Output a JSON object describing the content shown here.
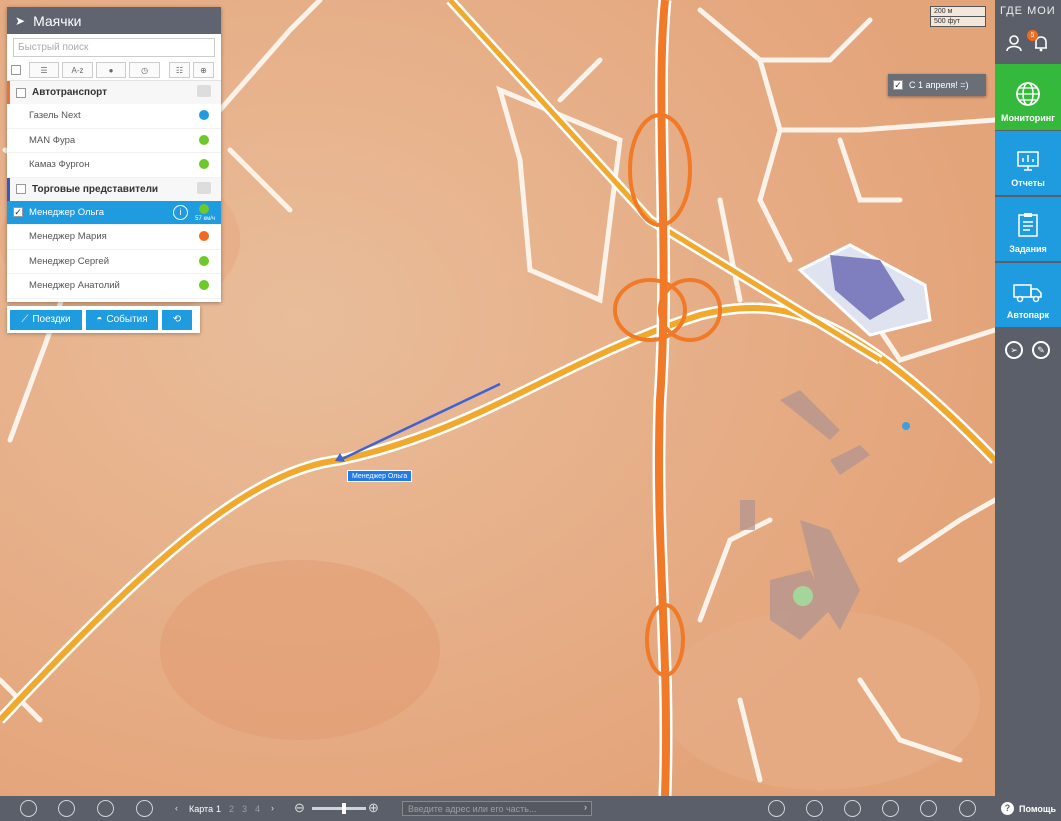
{
  "panel": {
    "title": "Маячки",
    "search_placeholder": "Быстрый поиск",
    "sort_az_label": "A-z",
    "groups": [
      {
        "label": "Автотранспорт",
        "items": [
          {
            "label": "Газель Next",
            "status_color": "#1f9be0"
          },
          {
            "label": "MAN Фура",
            "status_color": "#6dc92a"
          },
          {
            "label": "Камаз Фургон",
            "status_color": "#6dc92a"
          }
        ]
      },
      {
        "label": "Торговые представители",
        "items": [
          {
            "label": "Менеджер Ольга",
            "status_color": "#6dc92a",
            "speed": "57 км/ч",
            "selected": true
          },
          {
            "label": "Менеджер Мария",
            "status_color": "#f06a1f"
          },
          {
            "label": "Менеджер Сергей",
            "status_color": "#6dc92a"
          },
          {
            "label": "Менеджер Анатолий",
            "status_color": "#6dc92a"
          }
        ]
      }
    ],
    "buttons": {
      "trips": "Поездки",
      "events": "События"
    }
  },
  "map": {
    "scale_metric": "200 м",
    "scale_imperial": "500 фут",
    "notice_text": "С 1 апреля! =)",
    "marker_label": "Менеджер Ольга"
  },
  "sidebar": {
    "logo": "ГДЕ МОИ",
    "notification_count": "5",
    "nav": [
      {
        "label": "Мониторинг",
        "icon": "globe-icon",
        "active": true
      },
      {
        "label": "Отчеты",
        "icon": "chart-icon"
      },
      {
        "label": "Задания",
        "icon": "clipboard-icon"
      },
      {
        "label": "Автопарк",
        "icon": "truck-icon"
      }
    ]
  },
  "bottom": {
    "map_label": "Карта",
    "map_pages": [
      "1",
      "2",
      "3",
      "4"
    ],
    "address_placeholder": "Введите адрес или его часть...",
    "help_label": "Помощь"
  },
  "colors": {
    "accent_blue": "#1f9be0",
    "active_green": "#35b93d",
    "chrome_gray": "#5a5f69"
  }
}
